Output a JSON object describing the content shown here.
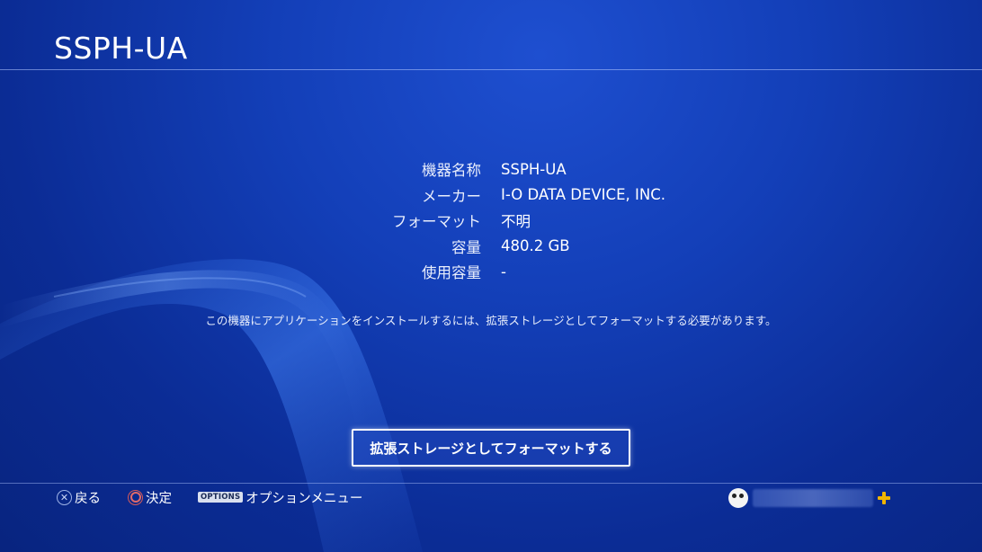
{
  "header": {
    "title": "SSPH-UA"
  },
  "device_info": {
    "rows": [
      {
        "label": "機器名称",
        "value": "SSPH-UA"
      },
      {
        "label": "メーカー",
        "value": "I-O DATA DEVICE, INC."
      },
      {
        "label": "フォーマット",
        "value": "不明"
      },
      {
        "label": "容量",
        "value": "480.2 GB"
      },
      {
        "label": "使用容量",
        "value": "-"
      }
    ]
  },
  "notice": "この機器にアプリケーションをインストールするには、拡張ストレージとしてフォーマットする必要があります。",
  "actions": {
    "format_button_label": "拡張ストレージとしてフォーマットする"
  },
  "footer": {
    "back_label": "戻る",
    "enter_label": "決定",
    "options_badge": "OPTIONS",
    "options_label": "オプションメニュー",
    "icons": {
      "back": "cross-button-icon",
      "enter": "circle-button-icon",
      "user": "avatar-icon",
      "plus": "playstation-plus-icon"
    },
    "colors": {
      "plus": "#f0b400",
      "circle": "#e06a6a"
    }
  }
}
